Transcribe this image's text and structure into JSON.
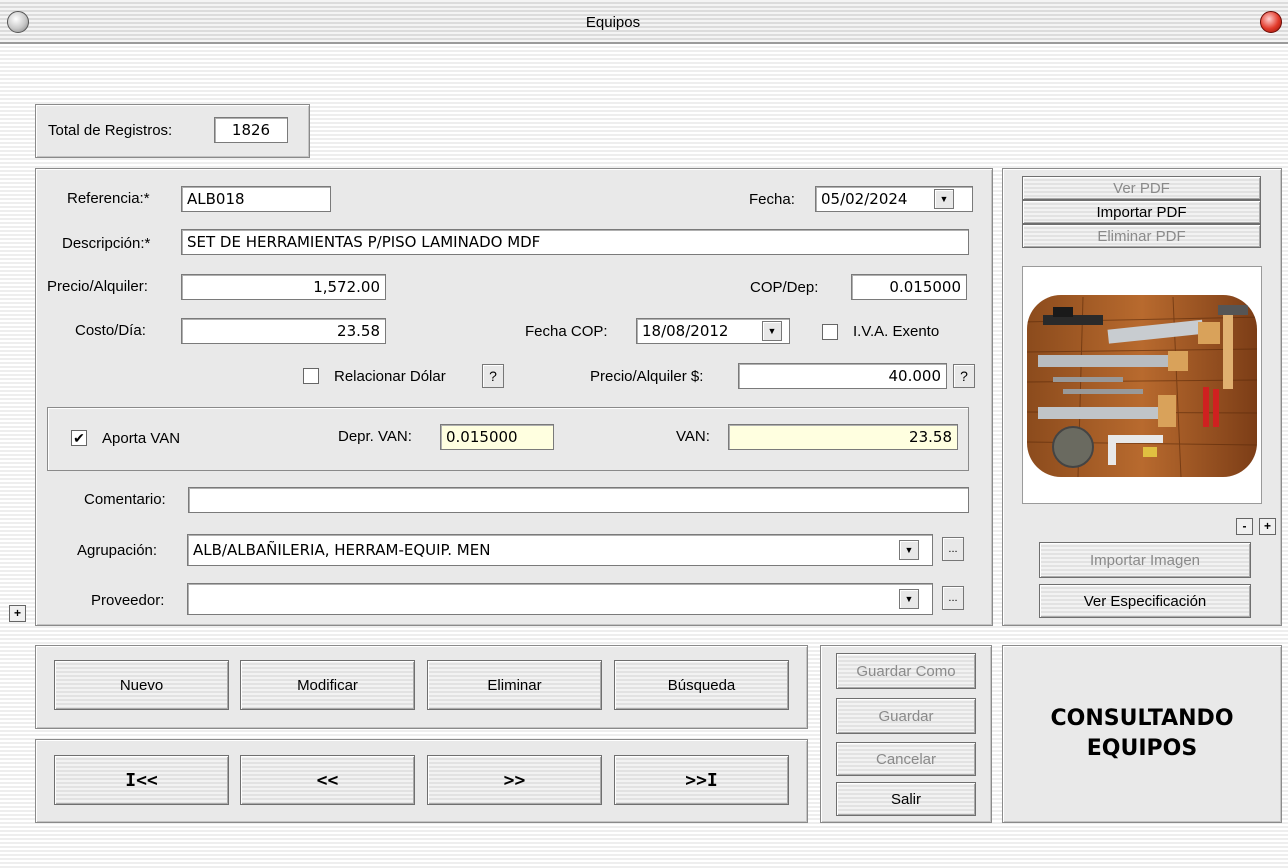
{
  "window": {
    "title": "Equipos"
  },
  "total": {
    "label": "Total de Registros:",
    "value": "1826"
  },
  "form": {
    "referencia_label": "Referencia:*",
    "referencia_value": "ALB018",
    "fecha_label": "Fecha:",
    "fecha_value": "05/02/2024",
    "descripcion_label": "Descripción:*",
    "descripcion_value": "SET DE HERRAMIENTAS P/PISO LAMINADO MDF",
    "precio_label": "Precio/Alquiler:",
    "precio_value": "1,572.00",
    "copdep_label": "COP/Dep:",
    "copdep_value": "0.015000",
    "costo_label": "Costo/Día:",
    "costo_value": "23.58",
    "fechacop_label": "Fecha COP:",
    "fechacop_value": "18/08/2012",
    "iva_label": "I.V.A. Exento",
    "iva_checked": false,
    "relacionar_label": "Relacionar Dólar",
    "relacionar_checked": false,
    "help_label": "?",
    "preciousd_label": "Precio/Alquiler $:",
    "preciousd_value": "40.000",
    "aporta_label": "Aporta VAN",
    "aporta_check": "✔",
    "deprvan_label": "Depr. VAN:",
    "deprvan_value": "0.015000",
    "van_label": "VAN:",
    "van_value": "23.58",
    "comentario_label": "Comentario:",
    "comentario_value": "",
    "agrupacion_label": "Agrupación:",
    "agrupacion_value": "ALB/ALBAÑILERIA, HERRAM-EQUIP. MEN",
    "proveedor_label": "Proveedor:",
    "proveedor_value": "",
    "ellipsis": "..."
  },
  "side": {
    "ver_pdf": "Ver PDF",
    "importar_pdf": "Importar PDF",
    "eliminar_pdf": "Eliminar PDF",
    "zoom_out": "-",
    "zoom_in": "+",
    "importar_imagen": "Importar Imagen",
    "ver_especificacion": "Ver Especificación"
  },
  "actions": {
    "nuevo": "Nuevo",
    "modificar": "Modificar",
    "eliminar": "Eliminar",
    "busqueda": "Búsqueda"
  },
  "nav": {
    "first": "I<<",
    "prev": "<<",
    "next": ">>",
    "last": ">>I"
  },
  "save": {
    "guardar_como": "Guardar Como",
    "guardar": "Guardar",
    "cancelar": "Cancelar",
    "salir": "Salir"
  },
  "status": {
    "line1": "CONSULTANDO",
    "line2": "EQUIPOS"
  },
  "expand_label": "+",
  "icons": {
    "dropdown": "chevron-down-icon",
    "photo": "tools-photo"
  }
}
